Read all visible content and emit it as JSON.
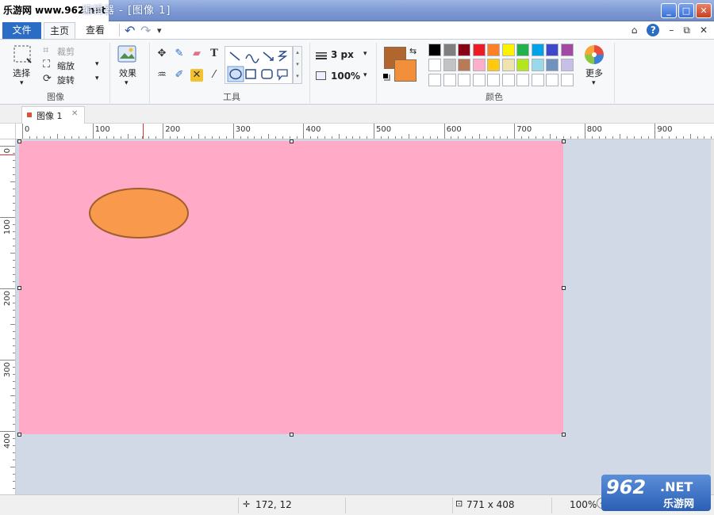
{
  "watermark_top": "乐游网 www.962.net",
  "window": {
    "title": "编辑器 - [图像 1]",
    "min": "_",
    "max": "□",
    "close": "✕"
  },
  "menu": {
    "file": "文件",
    "home": "主页",
    "view": "查看",
    "undo": "↶",
    "redo": "↷",
    "qa_drop": "▾",
    "right_icons": [
      "⌂",
      "?",
      "–",
      "⧉",
      "✕"
    ]
  },
  "ribbon": {
    "select": "选择",
    "crop": "裁剪",
    "resize": "缩放",
    "rotate": "旋转",
    "image_group": "图像",
    "effects": "效果",
    "tools_group": "工具",
    "stroke_size": "3 px",
    "zoom_level": "100%",
    "colors_group": "颜色",
    "more": "更多",
    "primary_color": "#b0662e",
    "secondary_color": "#f28f3b",
    "palette_row1": [
      "#000000",
      "#7f7f7f",
      "#880015",
      "#ed1c24",
      "#ff7f27",
      "#fff200",
      "#22b14c",
      "#00a2e8",
      "#3f48cc",
      "#a349a4"
    ],
    "palette_row2": [
      "#ffffff",
      "#c3c3c3",
      "#b97a57",
      "#ffaec9",
      "#ffc90e",
      "#efe4b0",
      "#b5e61d",
      "#99d9ea",
      "#7092be",
      "#c8bfe7"
    ],
    "palette_row3": [
      "#ffffff",
      "#ffffff",
      "#ffffff",
      "#ffffff",
      "#ffffff",
      "#ffffff",
      "#ffffff",
      "#ffffff",
      "#ffffff",
      "#ffffff"
    ]
  },
  "doc_tab": {
    "label": "图像 1",
    "close": "✕"
  },
  "ruler": {
    "h_labels": [
      "0",
      "100",
      "200",
      "300",
      "400",
      "500",
      "600",
      "700",
      "800",
      "900"
    ],
    "v_labels": [
      "0",
      "100",
      "200",
      "300",
      "400"
    ]
  },
  "canvas": {
    "background": "#ffabc8",
    "ellipse_fill": "#f8994b",
    "ellipse_stroke": "#a25f2b"
  },
  "status": {
    "cursor_pos": "172, 12",
    "image_size": "771 x 408",
    "zoom": "100%"
  },
  "watermark_bottom": {
    "big": "962",
    "net": ".NET",
    "cn": "乐游网"
  }
}
